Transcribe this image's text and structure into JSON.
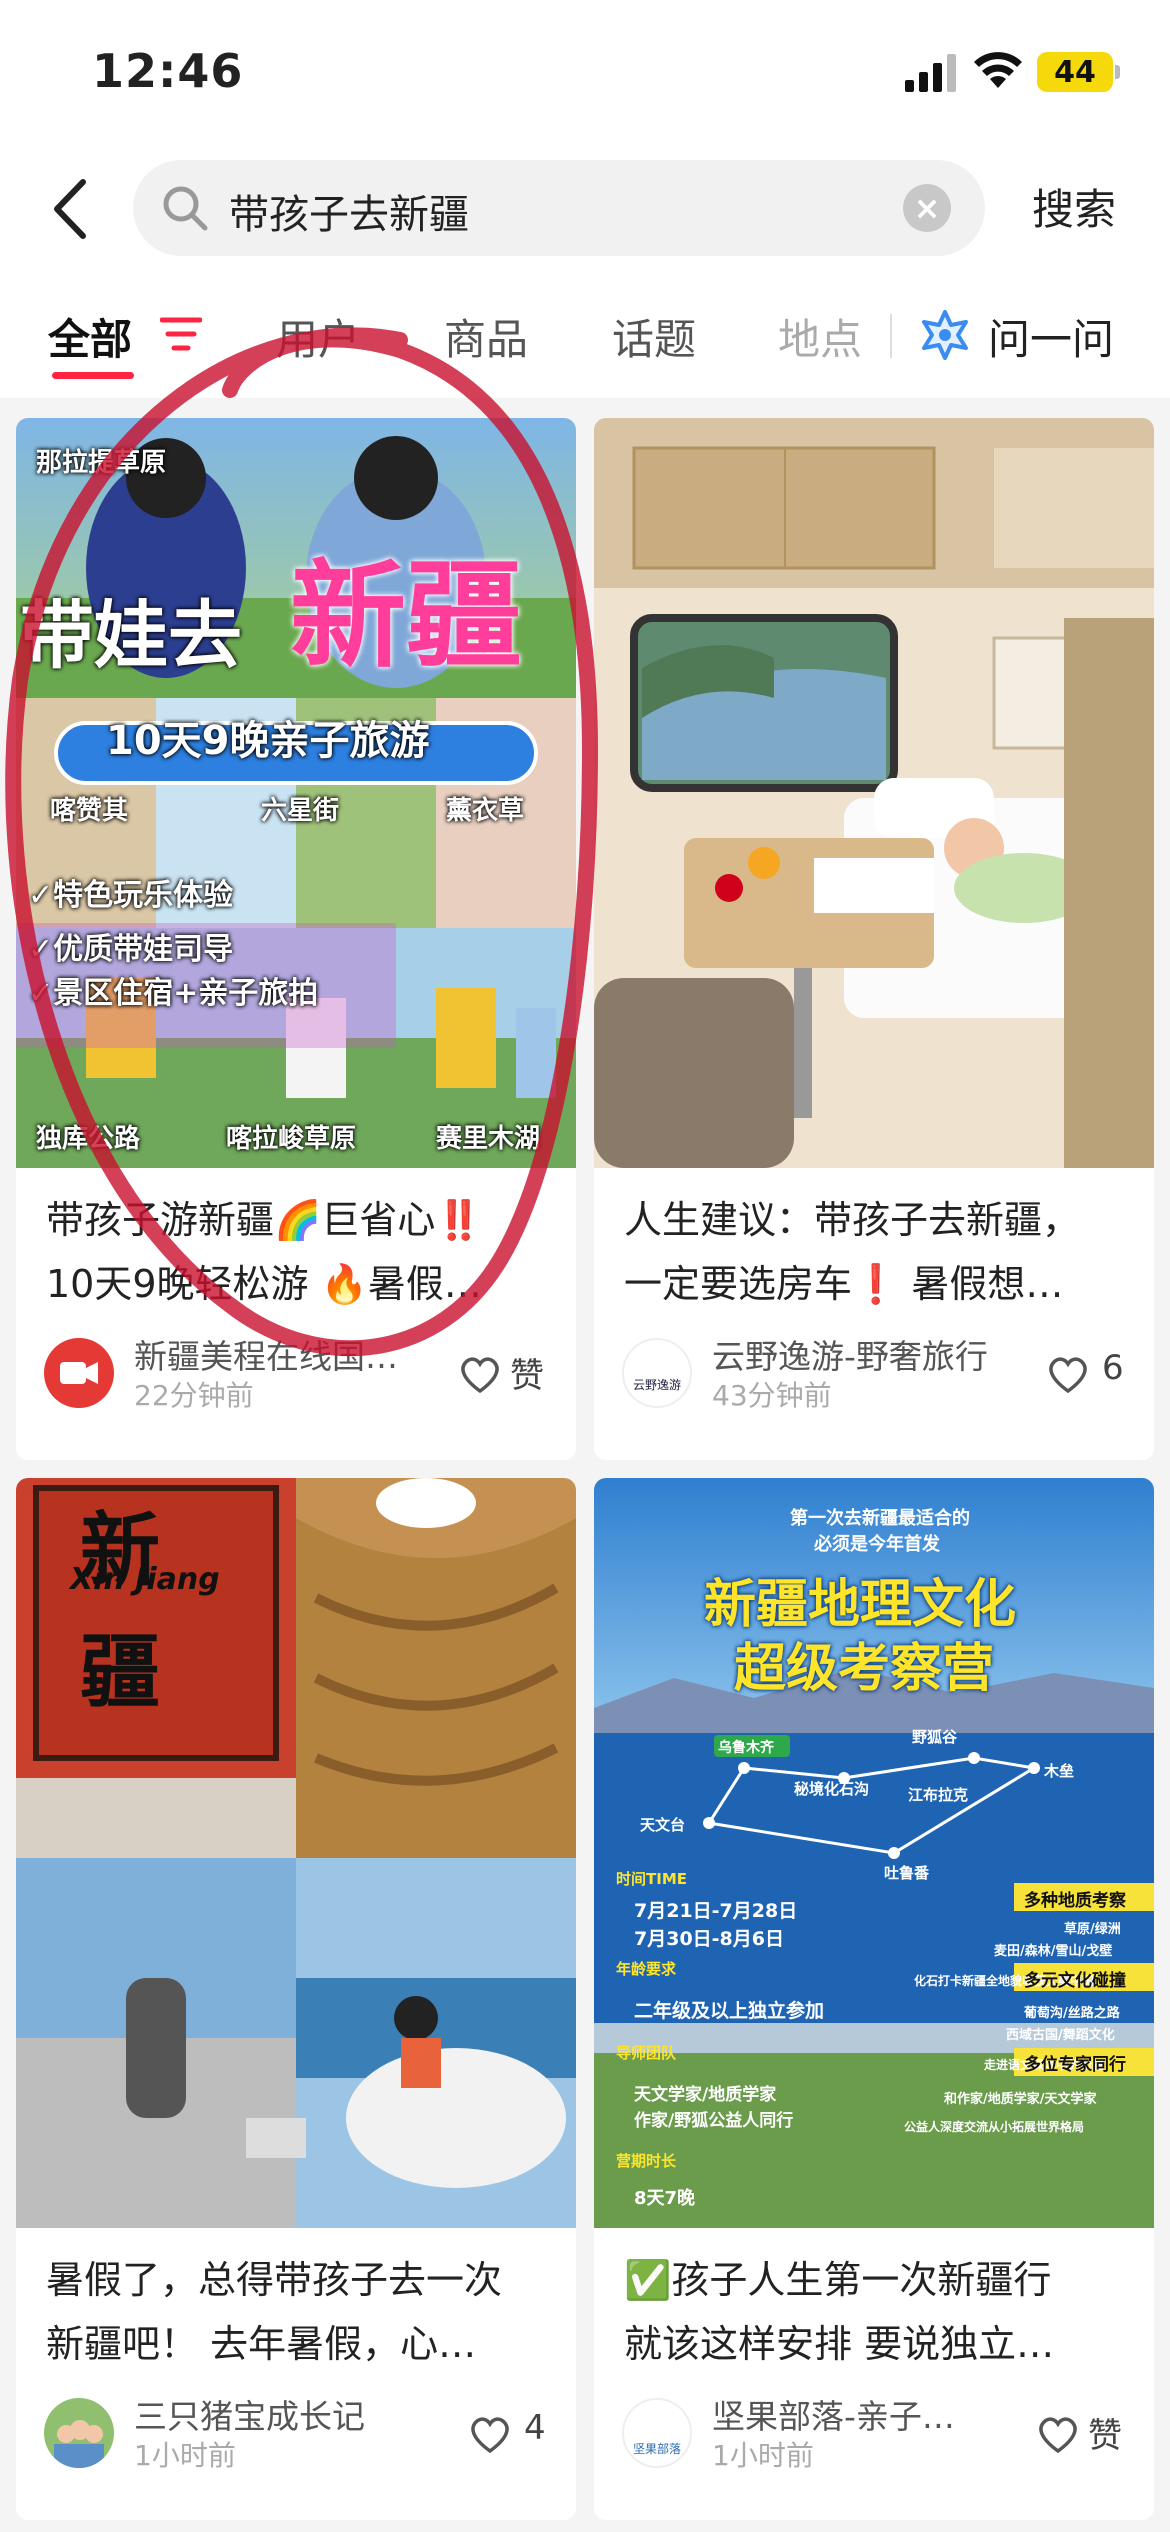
{
  "status_bar": {
    "time": "12:46",
    "battery": "44"
  },
  "search": {
    "query": "带孩子去新疆",
    "clear_label": "×",
    "submit_label": "搜索"
  },
  "tabs": [
    {
      "label": "全部",
      "active": true
    },
    {
      "label": "用户"
    },
    {
      "label": "商品"
    },
    {
      "label": "话题"
    },
    {
      "label": "地点"
    },
    {
      "label": "问一问"
    }
  ],
  "posts": [
    {
      "image_texts": {
        "location_top": "那拉提草原",
        "headline_a": "带娃去",
        "headline_b": "新疆",
        "banner": "10天9晚亲子旅游",
        "spot_1": "喀赞其",
        "spot_2": "六星街",
        "spot_3": "薰衣草",
        "feature_1": "✓特色玩乐体验",
        "feature_2": "✓优质带娃司导",
        "feature_3": "✓景区住宿+亲子旅拍",
        "spot_4": "独库公路",
        "spot_5": "喀拉峻草原",
        "spot_6": "赛里木湖"
      },
      "title_line1": "带孩子游新疆🌈巨省心‼️",
      "title_line2": "10天9晚轻松游 🔥暑假…",
      "author": "新疆美程在线国…",
      "time": "22分钟前",
      "likes": "赞"
    },
    {
      "title_line1": "人生建议：带孩子去新疆，",
      "title_line2": "一定要选房车❗ 暑假想…",
      "author": "云野逸游-野奢旅行",
      "avatar_text": "云野逸游",
      "time": "43分钟前",
      "likes": "6"
    },
    {
      "image_texts": {
        "sign_1": "新",
        "sign_2": "疆",
        "sign_en": "Xin Jiang"
      },
      "title_line1": "暑假了，总得带孩子去一次",
      "title_line2": "新疆吧！ 去年暑假，心…",
      "author": "三只猪宝成长记",
      "time": "1小时前",
      "likes": "4"
    },
    {
      "image_texts": {
        "top_small_1": "第一次去新疆最适合的",
        "top_small_2": "必须是今年首发",
        "headline_1": "新疆地理文化",
        "headline_2": "超级考察营",
        "map_urumqi": "乌鲁木齐",
        "map_yejugou": "野狐谷",
        "map_mubei": "秘境化石沟",
        "map_jiangbula": "江布拉克",
        "map_mulei": "木垒",
        "map_tiantai": "天文台",
        "map_turpan": "吐鲁番",
        "time_label": "时间TIME",
        "date_1": "7月21日-7月28日",
        "date_2": "7月30日-8月6日",
        "age_label": "年龄要求",
        "age_value": "二年级及以上独立参加",
        "tag_1": "多种地质考察",
        "tag_1_sub_1": "草原/绿洲",
        "tag_1_sub_2": "麦田/森林/雪山/戈壁",
        "tag_1_sub_3": "化石打卡新疆全地貌收获大美中国",
        "tag_2": "多元文化碰撞",
        "tag_2_sub_1": "葡萄沟/丝路之路",
        "tag_2_sub_2": "西域古国/舞蹈文化",
        "tag_2_sub_3": "走进语文课本中的新疆",
        "tag_3": "多位专家同行",
        "tag_3_sub_1": "和作家/地质学家/天文学家",
        "tag_3_sub_2": "公益人深度交流从小拓展世界格局",
        "team_label": "导师团队",
        "team_1": "天文学家/地质学家",
        "team_2": "作家/野狐公益人同行",
        "duration_label": "营期时长",
        "duration_value": "8天7晚"
      },
      "title_line1": "✅孩子人生第一次新疆行",
      "title_line2": "就该这样安排 要说独立…",
      "author": "坚果部落-亲子…",
      "avatar_text": "坚果部落",
      "time": "1小时前",
      "likes": "赞"
    }
  ],
  "colors": {
    "accent": "#ff2442",
    "annotation": "#c8102e"
  }
}
